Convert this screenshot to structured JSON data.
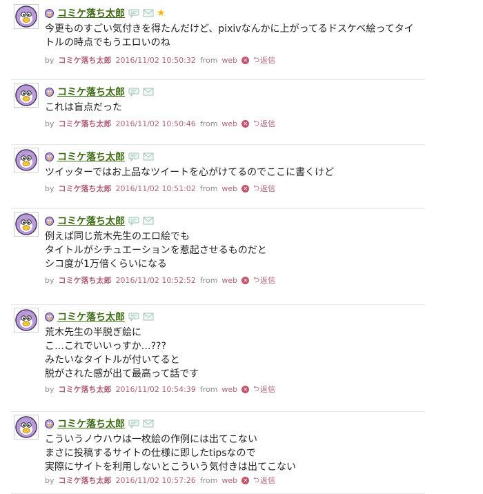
{
  "posts": [
    {
      "user": "コミケ落ち太郎",
      "faved": true,
      "lines": [
        "今更ものすごい気付きを得たんだけど、pixivなんかに上がってるドスケベ絵ってタイ",
        "トルの時点でもうエロいのね"
      ],
      "by": "by",
      "meta_user": "コミケ落ち太郎",
      "datetime": "2016/11/02 10:50:32",
      "from": "from",
      "source": "web",
      "reply": "返信"
    },
    {
      "user": "コミケ落ち太郎",
      "faved": false,
      "lines": [
        "これは盲点だった"
      ],
      "by": "by",
      "meta_user": "コミケ落ち太郎",
      "datetime": "2016/11/02 10:50:46",
      "from": "from",
      "source": "web",
      "reply": "返信"
    },
    {
      "user": "コミケ落ち太郎",
      "faved": false,
      "lines": [
        "ツイッターではお上品なツイートを心がけてるのでここに書くけど"
      ],
      "by": "by",
      "meta_user": "コミケ落ち太郎",
      "datetime": "2016/11/02 10:51:02",
      "from": "from",
      "source": "web",
      "reply": "返信"
    },
    {
      "user": "コミケ落ち太郎",
      "faved": false,
      "lines": [
        "例えば同じ荒木先生のエロ絵でも",
        "タイトルがシチュエーションを惹起させるものだと",
        "シコ度が1万倍くらいになる"
      ],
      "by": "by",
      "meta_user": "コミケ落ち太郎",
      "datetime": "2016/11/02 10:52:52",
      "from": "from",
      "source": "web",
      "reply": "返信"
    },
    {
      "user": "コミケ落ち太郎",
      "faved": false,
      "lines": [
        "荒木先生の半脱ぎ絵に",
        "こ…これでいいっすか…???",
        "みたいなタイトルが付いてると",
        "脱がされた感が出て最高って話です"
      ],
      "by": "by",
      "meta_user": "コミケ落ち太郎",
      "datetime": "2016/11/02 10:54:39",
      "from": "from",
      "source": "web",
      "reply": "返信"
    },
    {
      "user": "コミケ落ち太郎",
      "faved": false,
      "lines": [
        "こういうノウハウは一枚絵の作例には出てこない",
        "まさに投稿するサイトの仕様に即したtipsなので",
        "実際にサイトを利用しないとこういう気付きは出てこない"
      ],
      "by": "by",
      "meta_user": "コミケ落ち太郎",
      "datetime": "2016/11/02 10:57:26",
      "from": "from",
      "source": "web",
      "reply": "返信"
    }
  ],
  "icons": {
    "avatar": "penguin-avatar-icon",
    "user_badge": "user-badge-icon",
    "comment": "comment-bubble-icon",
    "mail": "envelope-icon",
    "fav": "star-icon",
    "delete": "delete-x-icon",
    "reply": "reply-arrow-icon"
  },
  "colors": {
    "username": "#3d6a14",
    "meta_link": "#b06278",
    "delete": "#c5546b",
    "star": "#f5b400"
  }
}
